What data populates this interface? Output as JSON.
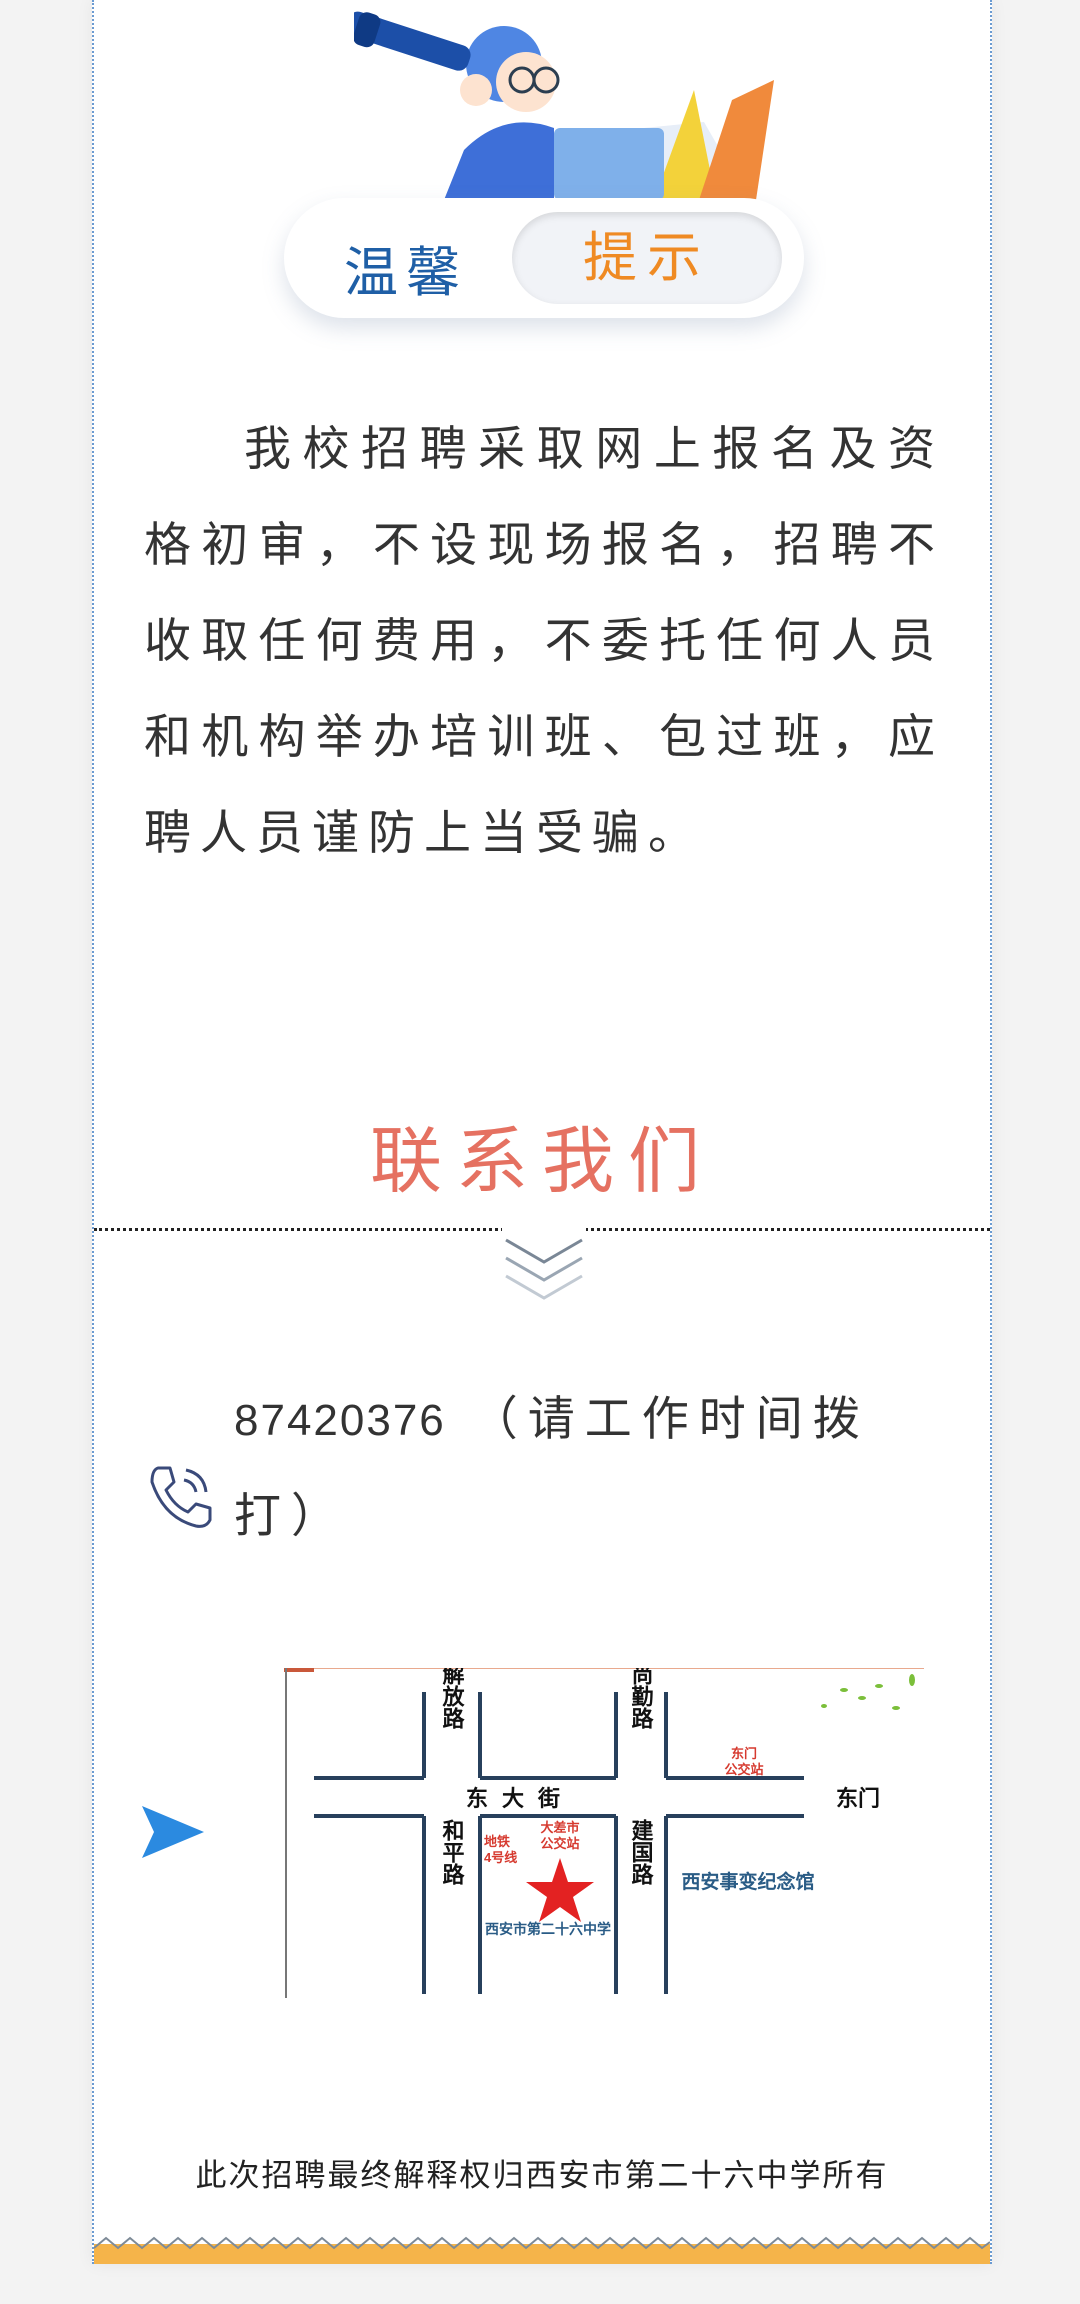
{
  "tip_banner": {
    "left": "温馨",
    "right": "提示"
  },
  "notice": {
    "text": "我校招聘采取网上报名及资格初审，不设现场报名，招聘不收取任何费用，不委托任何人员和机构举办培训班、包过班，应聘人员谨防上当受骗。"
  },
  "contact": {
    "title": "联系我们",
    "phone": "87420376",
    "phone_note": "（请工作时间拨打）"
  },
  "map": {
    "roads": {
      "jiefang": "解放路",
      "shangqin": "尚勤路",
      "dongda": "东大街",
      "heping": "和平路",
      "jianguo": "建国路",
      "dongmen": "东门"
    },
    "labels": {
      "metro_a": "地铁",
      "metro_b": "4号线",
      "bus_stop_a": "大差市",
      "bus_stop_b": "公交站",
      "dongmen_stop_a": "东门",
      "dongmen_stop_b": "公交站",
      "school": "西安市第二十六中学",
      "memorial": "西安事变纪念馆"
    }
  },
  "footer": {
    "text": "此次招聘最终解释权归西安市第二十六中学所有"
  },
  "colors": {
    "blue": "#1f5fa6",
    "orange": "#ef8a23",
    "salmon": "#e57161",
    "map_red": "#d63a2f",
    "map_blue": "#2a5c86"
  },
  "icons": {
    "phone": "phone-icon",
    "arrow": "send-arrow-icon",
    "chevrons": "chevron-down-icon"
  }
}
